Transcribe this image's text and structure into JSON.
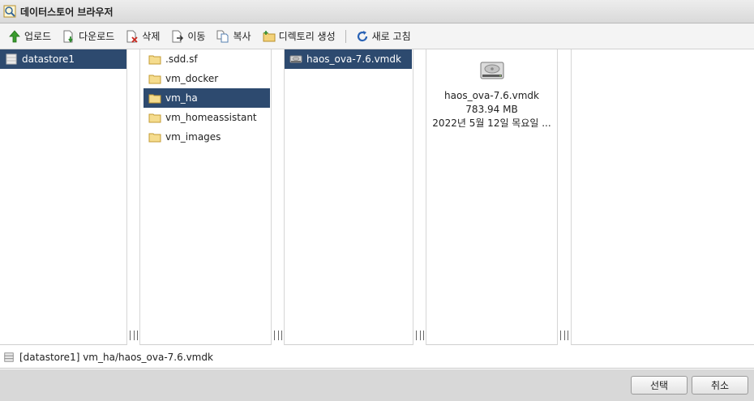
{
  "window": {
    "title": "데이터스토어 브라우저",
    "icon": "datastore-browser-icon"
  },
  "toolbar": {
    "buttons": [
      {
        "label": "업로드",
        "icon": "upload-arrow-icon"
      },
      {
        "label": "다운로드",
        "icon": "download-icon"
      },
      {
        "label": "삭제",
        "icon": "delete-icon"
      },
      {
        "label": "이동",
        "icon": "move-icon"
      },
      {
        "label": "복사",
        "icon": "copy-icon"
      },
      {
        "label": "디렉토리 생성",
        "icon": "new-folder-icon"
      },
      {
        "label": "새로 고침",
        "icon": "refresh-icon"
      }
    ]
  },
  "columns": {
    "datastores": [
      {
        "name": "datastore1",
        "selected": true
      }
    ],
    "folders": [
      {
        "name": ".sdd.sf",
        "selected": false
      },
      {
        "name": "vm_docker",
        "selected": false
      },
      {
        "name": "vm_ha",
        "selected": true
      },
      {
        "name": "vm_homeassistant",
        "selected": false
      },
      {
        "name": "vm_images",
        "selected": false
      }
    ],
    "files": [
      {
        "name": "haos_ova-7.6.vmdk",
        "selected": true
      }
    ]
  },
  "preview": {
    "name": "haos_ova-7.6.vmdk",
    "size": "783.94 MB",
    "date": "2022년 5월 12일 목요일 ..."
  },
  "status": {
    "path": "[datastore1] vm_ha/haos_ova-7.6.vmdk"
  },
  "footer": {
    "select_label": "선택",
    "cancel_label": "취소"
  },
  "colors": {
    "selection": "#2d4a6f",
    "toolbar_bg": "#f4f4f4",
    "footer_bg": "#d8d8d8"
  }
}
